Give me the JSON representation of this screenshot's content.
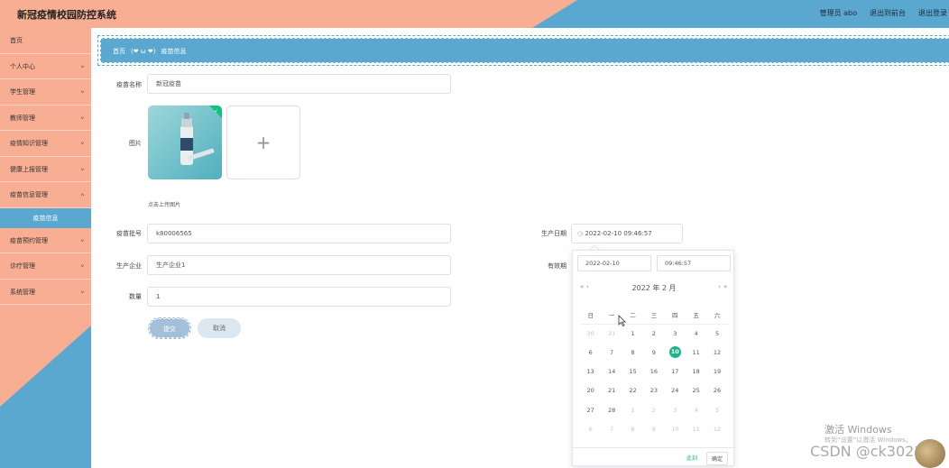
{
  "header": {
    "app_title": "新冠疫情校园防控系统",
    "admin_label": "管理员 abo",
    "front_label": "退出到前台",
    "logout_label": "退出登录"
  },
  "sidebar": {
    "items": [
      {
        "label": "首页"
      },
      {
        "label": "个人中心"
      },
      {
        "label": "学生管理"
      },
      {
        "label": "教师管理"
      },
      {
        "label": "疫情知识管理"
      },
      {
        "label": "健康上报管理"
      },
      {
        "label": "疫苗信息管理"
      },
      {
        "label": "疫苗信息"
      },
      {
        "label": "疫苗预约管理"
      },
      {
        "label": "诊疗管理"
      },
      {
        "label": "系统管理"
      }
    ]
  },
  "breadcrumb": {
    "home": "首页",
    "emoji": "(❤ ω ❤)",
    "current": "疫苗信息"
  },
  "form": {
    "name_label": "疫苗名称",
    "name_value": "新冠疫苗",
    "image_label": "图片",
    "upload_hint": "点击上传图片",
    "batch_label": "疫苗批号",
    "batch_value": "k80006565",
    "company_label": "生产企业",
    "company_value": "生产企业1",
    "qty_label": "数量",
    "qty_value": "1",
    "mfg_label": "生产日期",
    "mfg_value": "2022-02-10 09:46:57",
    "expiry_label": "有效期",
    "submit_label": "提交",
    "cancel_label": "取消"
  },
  "datepicker": {
    "date_value": "2022-02-10",
    "time_value": "09:46:57",
    "title": "2022 年  2 月",
    "prev_year": "«",
    "prev_month": "‹",
    "next_month": "›",
    "next_year": "»",
    "weekdays": [
      "日",
      "一",
      "二",
      "三",
      "四",
      "五",
      "六"
    ],
    "weeks": [
      [
        "30",
        "31",
        "1",
        "2",
        "3",
        "4",
        "5"
      ],
      [
        "6",
        "7",
        "8",
        "9",
        "10",
        "11",
        "12"
      ],
      [
        "13",
        "14",
        "15",
        "16",
        "17",
        "18",
        "19"
      ],
      [
        "20",
        "21",
        "22",
        "23",
        "24",
        "25",
        "26"
      ],
      [
        "27",
        "28",
        "1",
        "2",
        "3",
        "4",
        "5"
      ],
      [
        "6",
        "7",
        "8",
        "9",
        "10",
        "11",
        "12"
      ]
    ],
    "selected_day": "10",
    "now_label": "此刻",
    "ok_label": "确定"
  },
  "watermark": {
    "activate_title": "激活 Windows",
    "activate_sub": "转到“设置”以激活 Windows。",
    "csdn": "CSDN @ck3021"
  },
  "colors": {
    "peach": "#f7ae93",
    "blue": "#5aa7cf",
    "accent_green": "#1cb48a"
  }
}
